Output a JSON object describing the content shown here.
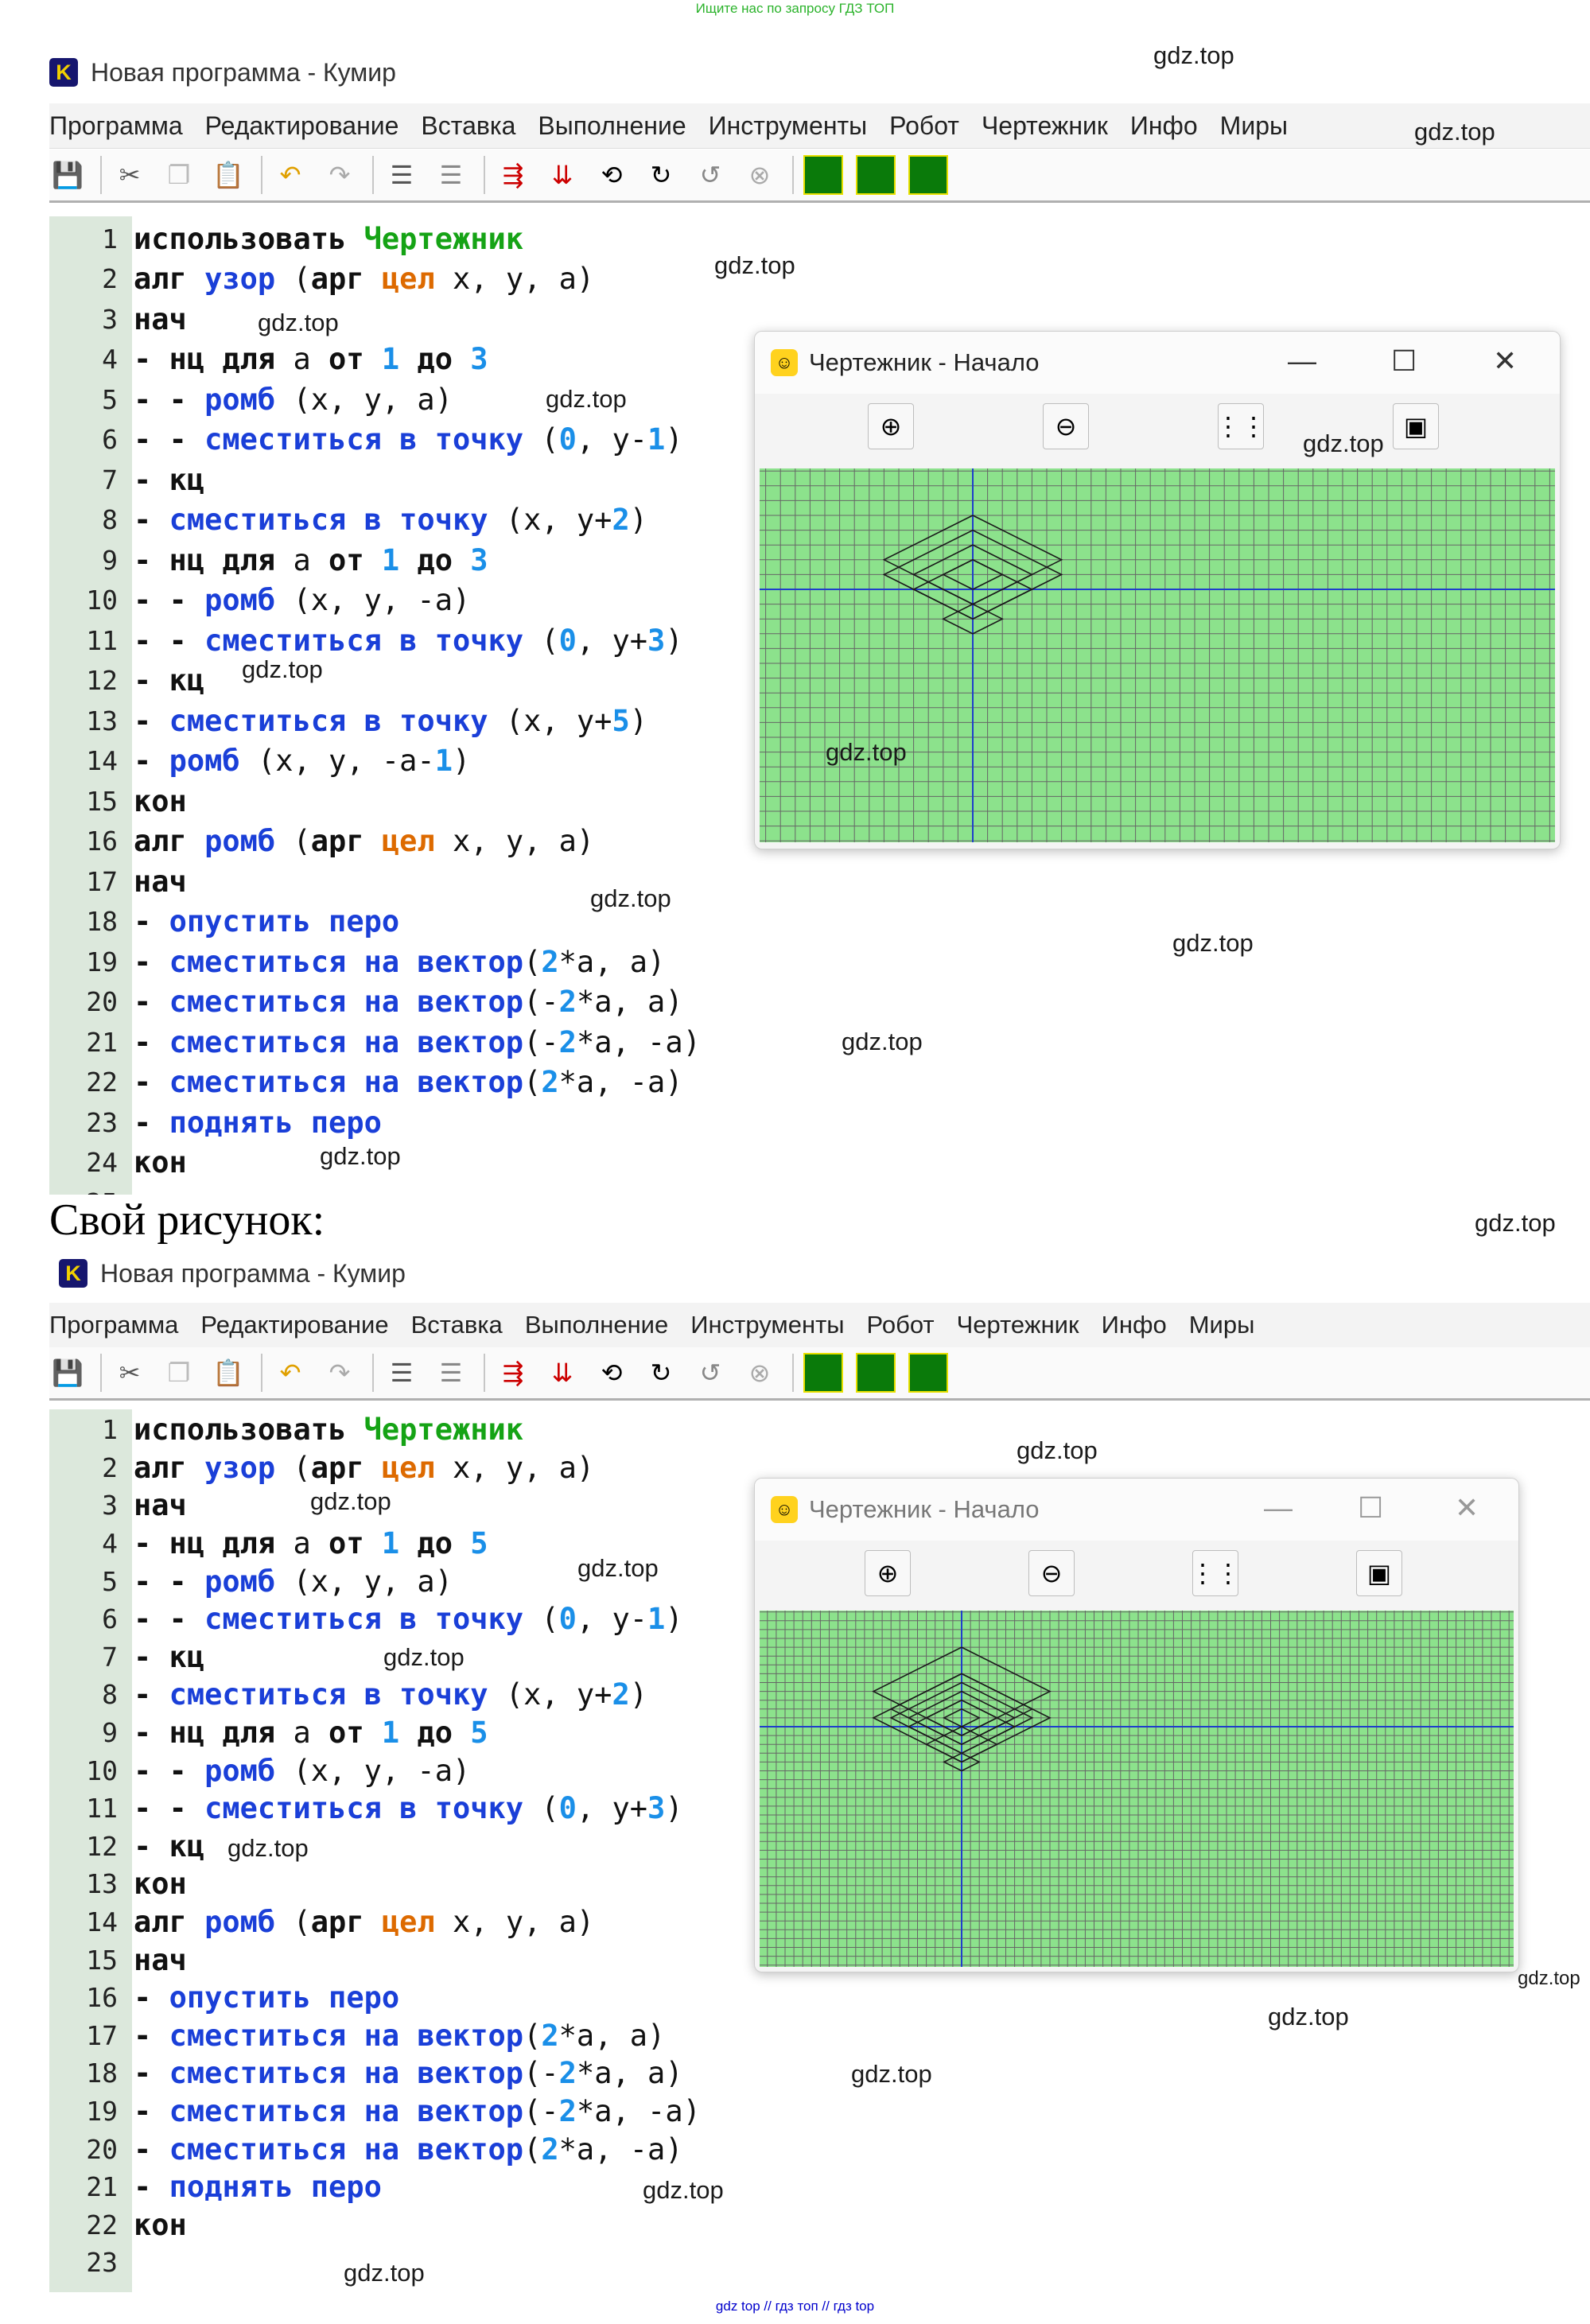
{
  "banner": "Ищите нас по запросу ГДЗ ТОП",
  "watermark": "gdz.top",
  "heading": "Свой рисунок:",
  "footer": "gdz top // гдз топ // гдз top",
  "window_title": "Новая программа - Кумир",
  "app_logo_letter": "K",
  "menu": [
    "Программа",
    "Редактирование",
    "Вставка",
    "Выполнение",
    "Инструменты",
    "Робот",
    "Чертежник",
    "Инфо",
    "Миры"
  ],
  "toolbar_icons": [
    "save-icon",
    "cut-icon",
    "copy-icon",
    "paste-icon",
    "undo-icon",
    "redo-icon",
    "indent-icon",
    "unindent-icon",
    "step-over-icon",
    "step-into-icon",
    "step-out-icon",
    "step-back-icon",
    "run-to-icon",
    "stop-icon",
    "grid-4-icon",
    "frame-icon",
    "grid-split-icon"
  ],
  "drawer": {
    "title": "Чертежник - Начало",
    "minimize": "—",
    "maximize": "☐",
    "close": "✕",
    "tools": [
      "zoom-in-icon",
      "zoom-out-icon",
      "grid-dots-icon",
      "fit-icon"
    ],
    "colors": {
      "background": "#8ce28c",
      "grid": "#666666",
      "axis": "#1f3fcc",
      "line": "#1a1a1a"
    }
  },
  "program1": {
    "lines": [
      {
        "n": "1",
        "t": [
          [
            "kw",
            "использовать "
          ],
          [
            "kw-green",
            "Чертежник"
          ]
        ]
      },
      {
        "n": "2",
        "t": [
          [
            "kw",
            "алг "
          ],
          [
            "kw-blue",
            "узор"
          ],
          [
            "plain",
            " ("
          ],
          [
            "kw",
            "арг "
          ],
          [
            "kw-orange",
            "цел"
          ],
          [
            "plain",
            " x, y, a)"
          ]
        ]
      },
      {
        "n": "3",
        "t": [
          [
            "kw",
            "нач"
          ]
        ]
      },
      {
        "n": "4",
        "t": [
          [
            "kw",
            "- нц для "
          ],
          [
            "plain",
            "a "
          ],
          [
            "kw",
            "от "
          ],
          [
            "num",
            "1"
          ],
          [
            "kw",
            " до "
          ],
          [
            "num",
            "3"
          ]
        ]
      },
      {
        "n": "5",
        "t": [
          [
            "kw",
            "- - "
          ],
          [
            "kw-blue",
            "ромб"
          ],
          [
            "plain",
            " (x, y, a)"
          ]
        ]
      },
      {
        "n": "6",
        "t": [
          [
            "kw",
            "- - "
          ],
          [
            "kw-blue",
            "сместиться в точку"
          ],
          [
            "plain",
            " ("
          ],
          [
            "num",
            "0"
          ],
          [
            "plain",
            ", y-"
          ],
          [
            "num",
            "1"
          ],
          [
            "plain",
            ")"
          ]
        ]
      },
      {
        "n": "7",
        "t": [
          [
            "kw",
            "- кц"
          ]
        ]
      },
      {
        "n": "8",
        "t": [
          [
            "kw",
            "- "
          ],
          [
            "kw-blue",
            "сместиться в точку"
          ],
          [
            "plain",
            " (x, y+"
          ],
          [
            "num",
            "2"
          ],
          [
            "plain",
            ")"
          ]
        ]
      },
      {
        "n": "9",
        "t": [
          [
            "kw",
            "- нц для "
          ],
          [
            "plain",
            "a "
          ],
          [
            "kw",
            "от "
          ],
          [
            "num",
            "1"
          ],
          [
            "kw",
            " до "
          ],
          [
            "num",
            "3"
          ]
        ]
      },
      {
        "n": "10",
        "t": [
          [
            "kw",
            "- - "
          ],
          [
            "kw-blue",
            "ромб"
          ],
          [
            "plain",
            " (x, y, -a)"
          ]
        ]
      },
      {
        "n": "11",
        "t": [
          [
            "kw",
            "- - "
          ],
          [
            "kw-blue",
            "сместиться в точку"
          ],
          [
            "plain",
            " ("
          ],
          [
            "num",
            "0"
          ],
          [
            "plain",
            ", y+"
          ],
          [
            "num",
            "3"
          ],
          [
            "plain",
            ")"
          ]
        ]
      },
      {
        "n": "12",
        "t": [
          [
            "kw",
            "- кц"
          ]
        ]
      },
      {
        "n": "13",
        "t": [
          [
            "kw",
            "- "
          ],
          [
            "kw-blue",
            "сместиться в точку"
          ],
          [
            "plain",
            " (x, y+"
          ],
          [
            "num",
            "5"
          ],
          [
            "plain",
            ")"
          ]
        ]
      },
      {
        "n": "14",
        "t": [
          [
            "kw",
            "- "
          ],
          [
            "kw-blue",
            "ромб"
          ],
          [
            "plain",
            " (x, y, -a-"
          ],
          [
            "num",
            "1"
          ],
          [
            "plain",
            ")"
          ]
        ]
      },
      {
        "n": "15",
        "t": [
          [
            "kw",
            "кон"
          ]
        ]
      },
      {
        "n": "16",
        "t": [
          [
            "kw",
            "алг "
          ],
          [
            "kw-blue",
            "ромб"
          ],
          [
            "plain",
            " ("
          ],
          [
            "kw",
            "арг "
          ],
          [
            "kw-orange",
            "цел"
          ],
          [
            "plain",
            " x, y, a)"
          ]
        ]
      },
      {
        "n": "17",
        "t": [
          [
            "kw",
            "нач"
          ]
        ]
      },
      {
        "n": "18",
        "t": [
          [
            "kw",
            "- "
          ],
          [
            "kw-blue",
            "опустить перо"
          ]
        ]
      },
      {
        "n": "19",
        "t": [
          [
            "kw",
            "- "
          ],
          [
            "kw-blue",
            "сместиться на вектор"
          ],
          [
            "plain",
            "("
          ],
          [
            "num",
            "2"
          ],
          [
            "plain",
            "*a, a)"
          ]
        ]
      },
      {
        "n": "20",
        "t": [
          [
            "kw",
            "- "
          ],
          [
            "kw-blue",
            "сместиться на вектор"
          ],
          [
            "plain",
            "(-"
          ],
          [
            "num",
            "2"
          ],
          [
            "plain",
            "*a, a)"
          ]
        ]
      },
      {
        "n": "21",
        "t": [
          [
            "kw",
            "- "
          ],
          [
            "kw-blue",
            "сместиться на вектор"
          ],
          [
            "plain",
            "(-"
          ],
          [
            "num",
            "2"
          ],
          [
            "plain",
            "*a, -a)"
          ]
        ]
      },
      {
        "n": "22",
        "t": [
          [
            "kw",
            "- "
          ],
          [
            "kw-blue",
            "сместиться на вектор"
          ],
          [
            "plain",
            "("
          ],
          [
            "num",
            "2"
          ],
          [
            "plain",
            "*a, -a)"
          ]
        ]
      },
      {
        "n": "23",
        "t": [
          [
            "kw",
            "- "
          ],
          [
            "kw-blue",
            "поднять перо"
          ]
        ]
      },
      {
        "n": "24",
        "t": [
          [
            "kw",
            "кон"
          ]
        ]
      },
      {
        "n": "25",
        "t": []
      }
    ]
  },
  "program2": {
    "lines": [
      {
        "n": "1",
        "t": [
          [
            "kw",
            "использовать "
          ],
          [
            "kw-green",
            "Чертежник"
          ]
        ]
      },
      {
        "n": "2",
        "t": [
          [
            "kw",
            "алг "
          ],
          [
            "kw-blue",
            "узор"
          ],
          [
            "plain",
            " ("
          ],
          [
            "kw",
            "арг "
          ],
          [
            "kw-orange",
            "цел"
          ],
          [
            "plain",
            " x, y, a)"
          ]
        ]
      },
      {
        "n": "3",
        "t": [
          [
            "kw",
            "нач"
          ]
        ]
      },
      {
        "n": "4",
        "t": [
          [
            "kw",
            "- нц для "
          ],
          [
            "plain",
            "a "
          ],
          [
            "kw",
            "от "
          ],
          [
            "num",
            "1"
          ],
          [
            "kw",
            " до "
          ],
          [
            "num",
            "5"
          ]
        ]
      },
      {
        "n": "5",
        "t": [
          [
            "kw",
            "- - "
          ],
          [
            "kw-blue",
            "ромб"
          ],
          [
            "plain",
            " (x, y, a)"
          ]
        ]
      },
      {
        "n": "6",
        "t": [
          [
            "kw",
            "- - "
          ],
          [
            "kw-blue",
            "сместиться в точку"
          ],
          [
            "plain",
            " ("
          ],
          [
            "num",
            "0"
          ],
          [
            "plain",
            ", y-"
          ],
          [
            "num",
            "1"
          ],
          [
            "plain",
            ")"
          ]
        ]
      },
      {
        "n": "7",
        "t": [
          [
            "kw",
            "- кц"
          ]
        ]
      },
      {
        "n": "8",
        "t": [
          [
            "kw",
            "- "
          ],
          [
            "kw-blue",
            "сместиться в точку"
          ],
          [
            "plain",
            " (x, y+"
          ],
          [
            "num",
            "2"
          ],
          [
            "plain",
            ")"
          ]
        ]
      },
      {
        "n": "9",
        "t": [
          [
            "kw",
            "- нц для "
          ],
          [
            "plain",
            "a "
          ],
          [
            "kw",
            "от "
          ],
          [
            "num",
            "1"
          ],
          [
            "kw",
            " до "
          ],
          [
            "num",
            "5"
          ]
        ]
      },
      {
        "n": "10",
        "t": [
          [
            "kw",
            "- - "
          ],
          [
            "kw-blue",
            "ромб"
          ],
          [
            "plain",
            " (x, y, -a)"
          ]
        ]
      },
      {
        "n": "11",
        "t": [
          [
            "kw",
            "- - "
          ],
          [
            "kw-blue",
            "сместиться в точку"
          ],
          [
            "plain",
            " ("
          ],
          [
            "num",
            "0"
          ],
          [
            "plain",
            ", y+"
          ],
          [
            "num",
            "3"
          ],
          [
            "plain",
            ")"
          ]
        ]
      },
      {
        "n": "12",
        "t": [
          [
            "kw",
            "- кц"
          ]
        ]
      },
      {
        "n": "13",
        "t": [
          [
            "kw",
            "кон"
          ]
        ]
      },
      {
        "n": "14",
        "t": [
          [
            "kw",
            "алг "
          ],
          [
            "kw-blue",
            "ромб"
          ],
          [
            "plain",
            " ("
          ],
          [
            "kw",
            "арг "
          ],
          [
            "kw-orange",
            "цел"
          ],
          [
            "plain",
            " x, y, a)"
          ]
        ]
      },
      {
        "n": "15",
        "t": [
          [
            "kw",
            "нач"
          ]
        ]
      },
      {
        "n": "16",
        "t": [
          [
            "kw",
            "- "
          ],
          [
            "kw-blue",
            "опустить перо"
          ]
        ]
      },
      {
        "n": "17",
        "t": [
          [
            "kw",
            "- "
          ],
          [
            "kw-blue",
            "сместиться на вектор"
          ],
          [
            "plain",
            "("
          ],
          [
            "num",
            "2"
          ],
          [
            "plain",
            "*a, a)"
          ]
        ]
      },
      {
        "n": "18",
        "t": [
          [
            "kw",
            "- "
          ],
          [
            "kw-blue",
            "сместиться на вектор"
          ],
          [
            "plain",
            "(-"
          ],
          [
            "num",
            "2"
          ],
          [
            "plain",
            "*a, a)"
          ]
        ]
      },
      {
        "n": "19",
        "t": [
          [
            "kw",
            "- "
          ],
          [
            "kw-blue",
            "сместиться на вектор"
          ],
          [
            "plain",
            "(-"
          ],
          [
            "num",
            "2"
          ],
          [
            "plain",
            "*a, -a)"
          ]
        ]
      },
      {
        "n": "20",
        "t": [
          [
            "kw",
            "- "
          ],
          [
            "kw-blue",
            "сместиться на вектор"
          ],
          [
            "plain",
            "("
          ],
          [
            "num",
            "2"
          ],
          [
            "plain",
            "*a, -a)"
          ]
        ]
      },
      {
        "n": "21",
        "t": [
          [
            "kw",
            "- "
          ],
          [
            "kw-blue",
            "поднять перо"
          ]
        ]
      },
      {
        "n": "22",
        "t": [
          [
            "kw",
            "кон"
          ]
        ]
      },
      {
        "n": "23",
        "t": []
      }
    ]
  },
  "drawings": {
    "drawing1": {
      "iterations": 3,
      "center": [
        0,
        0
      ]
    },
    "drawing2": {
      "iterations": 5,
      "center": [
        0,
        0
      ]
    }
  }
}
